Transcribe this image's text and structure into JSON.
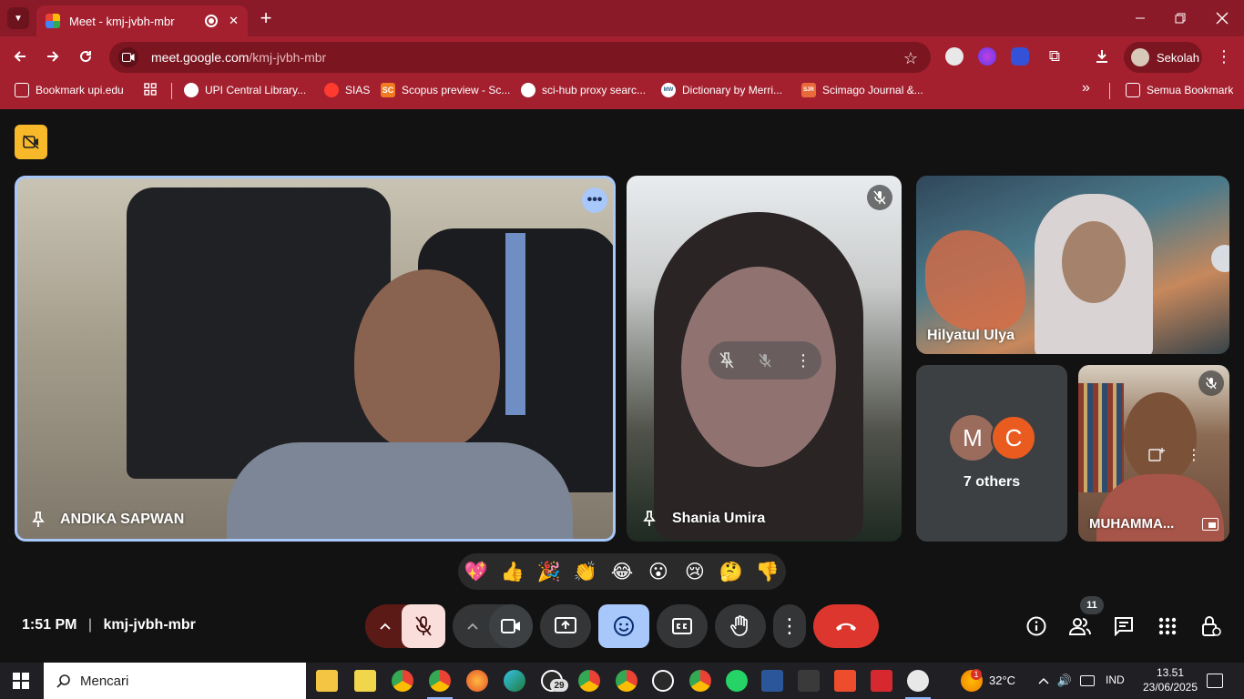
{
  "browser": {
    "tab_title": "Meet - kmj-jvbh-mbr",
    "new_tab": "+",
    "url_host": "meet.google.com",
    "url_path": "/kmj-jvbh-mbr",
    "profile_name": "Sekolah",
    "accent": "#a4202f"
  },
  "bookmarks": {
    "items": [
      "Bookmark upi.edu",
      "UPI Central Library...",
      "SIAS",
      "Scopus preview - Sc...",
      "sci-hub proxy searc...",
      "Dictionary by Merri...",
      "Scimago Journal &..."
    ],
    "favicons": [
      "SC",
      "MW",
      "SJR"
    ],
    "more": "»",
    "all": "Semua Bookmark"
  },
  "meet": {
    "participants": {
      "main": "ANDIKA SAPWAN",
      "second": "Shania Umira",
      "third": "Hilyatul Ulya",
      "others_label": "7 others",
      "others_initials": [
        "M",
        "C"
      ],
      "small": "MUHAMMA..."
    },
    "reactions": [
      "💖",
      "👍",
      "🎉",
      "👏",
      "😂",
      "😮",
      "😢",
      "🤔",
      "👎"
    ],
    "time": "1:51 PM",
    "separator": "|",
    "meeting_code": "kmj-jvbh-mbr",
    "participant_count": "11",
    "colors": {
      "end_call": "#dc362e",
      "active_blue": "#a8c7fa",
      "mute_bg": "#f9dedc",
      "speaker_border": "#a8c7fa"
    }
  },
  "taskbar": {
    "search_placeholder": "Mencari",
    "whatsapp_badge": "29",
    "weather_badge": "1",
    "temperature": "32°C",
    "language": "IND",
    "time": "13.51",
    "date": "23/06/2025"
  }
}
